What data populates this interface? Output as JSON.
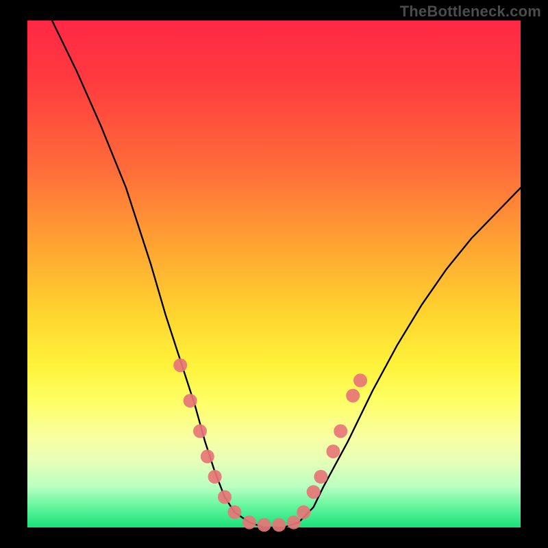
{
  "watermark": "TheBottleneck.com",
  "chart_data": {
    "type": "line",
    "title": "",
    "xlabel": "",
    "ylabel": "",
    "x_range": [
      0,
      100
    ],
    "y_range": [
      0,
      100
    ],
    "bands": [
      {
        "name": "red",
        "from": 100,
        "to": 55,
        "color_top": "#ff2845",
        "color_bottom": "#ffa632"
      },
      {
        "name": "yellow",
        "from": 55,
        "to": 18,
        "color_top": "#ffd52f",
        "color_bottom": "#feff65"
      },
      {
        "name": "green",
        "from": 18,
        "to": 0,
        "color_top": "#b8ffc1",
        "color_bottom": "#19e07a"
      }
    ],
    "series": [
      {
        "name": "bottleneck-curve",
        "color": "#000000",
        "x": [
          5,
          10,
          15,
          20,
          25,
          28,
          31,
          34,
          36,
          38,
          40,
          42,
          45,
          48,
          52,
          55,
          58,
          60,
          65,
          70,
          75,
          80,
          85,
          90,
          95,
          100
        ],
        "y": [
          100,
          90,
          79,
          67,
          52,
          42,
          33,
          24,
          17,
          11,
          6,
          3,
          1,
          0,
          0,
          1,
          4,
          8,
          17,
          27,
          36,
          44,
          51,
          57,
          62,
          67
        ]
      }
    ],
    "markers": {
      "name": "sample-points",
      "color": "#e77577",
      "radius": 10,
      "points": [
        {
          "x": 31,
          "y": 32
        },
        {
          "x": 33,
          "y": 25
        },
        {
          "x": 35,
          "y": 19
        },
        {
          "x": 36.5,
          "y": 14
        },
        {
          "x": 38,
          "y": 10
        },
        {
          "x": 40,
          "y": 6
        },
        {
          "x": 42,
          "y": 3
        },
        {
          "x": 45,
          "y": 1
        },
        {
          "x": 48,
          "y": 0.5
        },
        {
          "x": 51,
          "y": 0.5
        },
        {
          "x": 54,
          "y": 1
        },
        {
          "x": 56,
          "y": 3
        },
        {
          "x": 58,
          "y": 7
        },
        {
          "x": 59.5,
          "y": 10
        },
        {
          "x": 62,
          "y": 15
        },
        {
          "x": 63.5,
          "y": 19
        },
        {
          "x": 66,
          "y": 26
        },
        {
          "x": 67.5,
          "y": 29
        }
      ]
    }
  }
}
